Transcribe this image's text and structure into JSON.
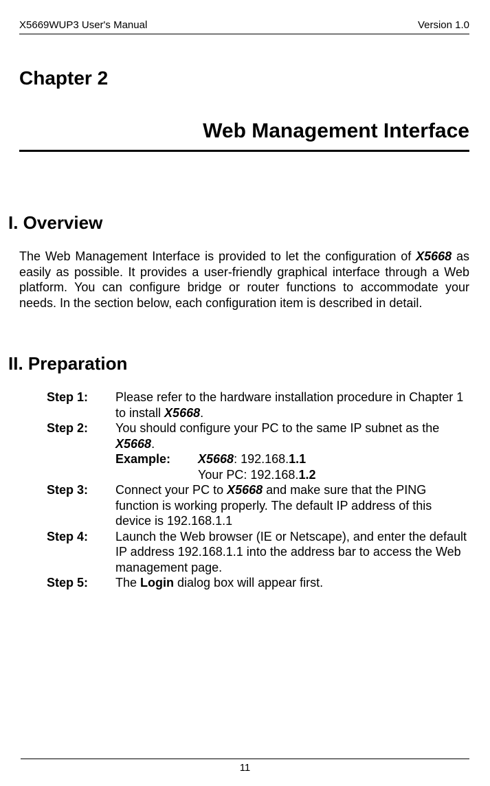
{
  "running_header": {
    "left": "X5669WUP3 User's Manual",
    "right": "Version 1.0"
  },
  "chapter": {
    "label": "Chapter 2",
    "title": "Web Management Interface"
  },
  "sections": {
    "overview": {
      "heading": "I.  Overview",
      "para_pre": "The Web Management Interface is provided to let the configuration of ",
      "product": "X5668",
      "para_post": " as easily as possible. It provides a user-friendly graphical interface through a Web platform. You can configure bridge or router functions to accommodate your needs. In the section below, each configuration item is described in detail."
    },
    "preparation": {
      "heading": "II.  Preparation",
      "steps": [
        {
          "label": "Step 1:",
          "text_pre": "Please refer to the hardware installation procedure in Chapter 1 to install ",
          "em": "X5668",
          "text_post": "."
        },
        {
          "label": "Step 2:",
          "text_pre": "You should configure your PC to the same IP subnet as the ",
          "em": "X5668",
          "text_post": ".",
          "example_label": "Example:",
          "example_product": "X5668",
          "example_ip_prefix": ": 192.168.",
          "example_ip_bold": "1.1",
          "your_pc_prefix": "Your PC: 192.168.",
          "your_pc_bold": "1.2"
        },
        {
          "label": "Step 3:",
          "text_pre": "Connect your PC to ",
          "em": "X5668",
          "text_post": " and make sure that the PING function is working properly. The default IP address of this device is 192.168.1.1"
        },
        {
          "label": "Step 4:",
          "text": "Launch the Web browser (IE or Netscape), and enter the default IP address 192.168.1.1 into the address bar to access the Web management page."
        },
        {
          "label": "Step 5:",
          "text_pre": "The ",
          "bold": "Login",
          "text_post": " dialog box will appear first."
        }
      ]
    }
  },
  "footer": {
    "page_number": "11"
  }
}
